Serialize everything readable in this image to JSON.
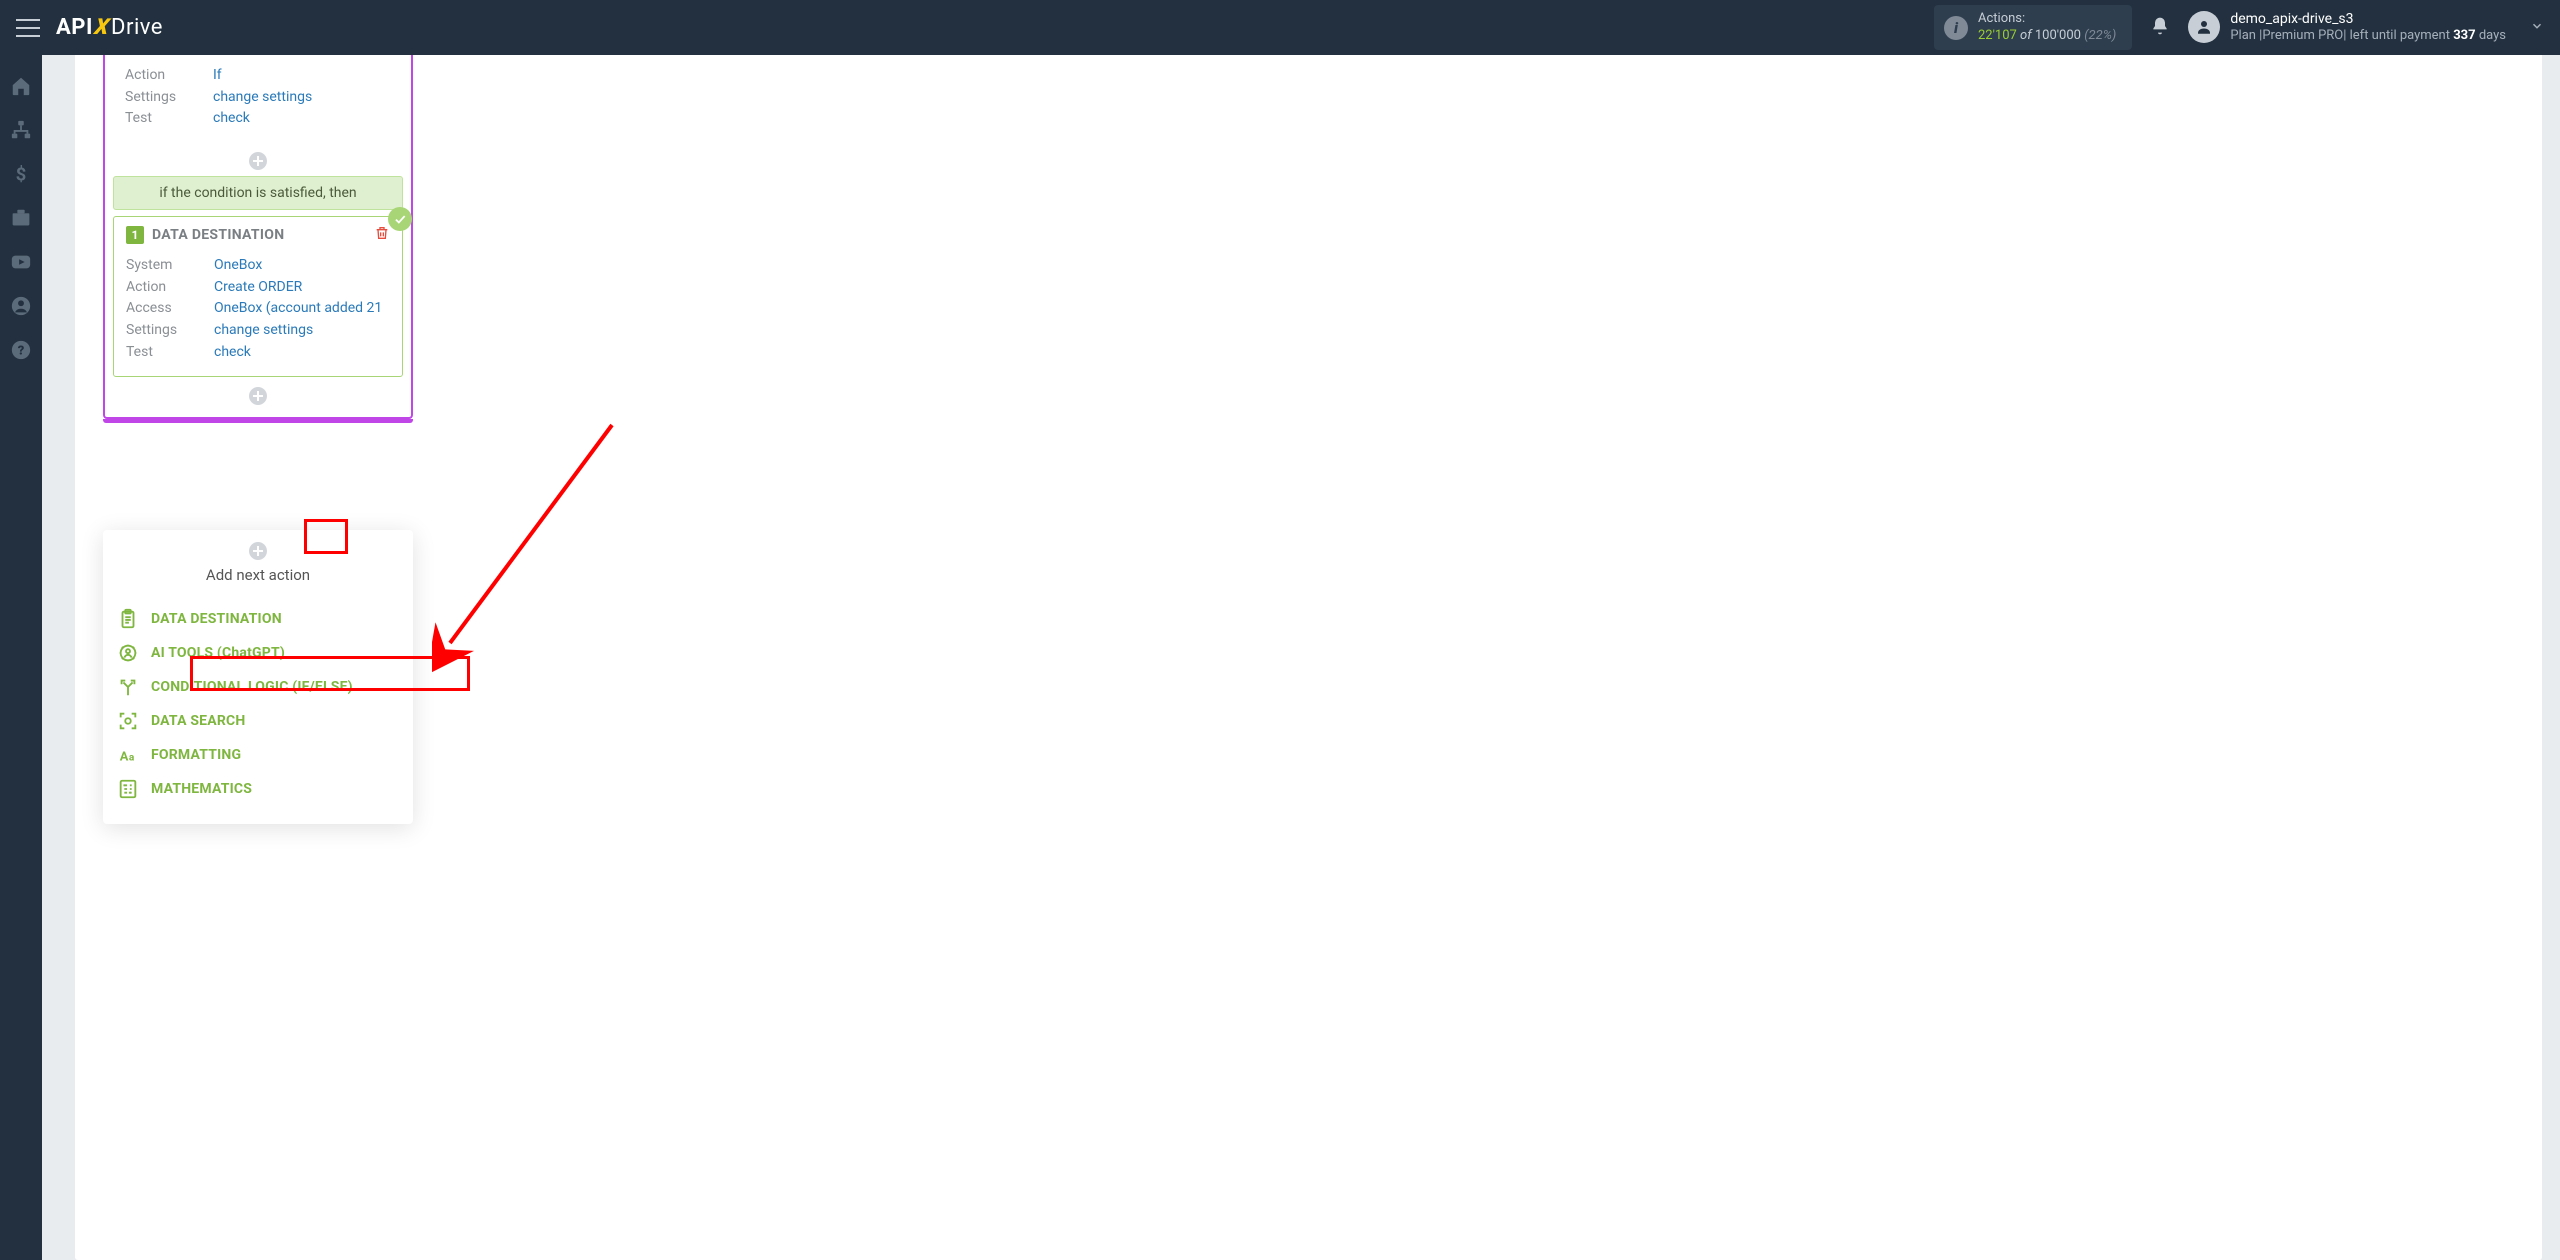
{
  "logo": {
    "api": "API",
    "x": "X",
    "drive": "Drive"
  },
  "header": {
    "actions_label": "Actions:",
    "actions_used": "22'107",
    "actions_of": "of",
    "actions_total": "100'000",
    "actions_pct": "(22%)",
    "username": "demo_apix-drive_s3",
    "plan_prefix": "Plan |Premium PRO| left until payment ",
    "plan_days": "337",
    "plan_suffix": " days"
  },
  "filter_card": {
    "rows": [
      {
        "k": "Action",
        "v": "If"
      },
      {
        "k": "Settings",
        "v": "change settings"
      },
      {
        "k": "Test",
        "v": "check"
      }
    ]
  },
  "condition_text": "if the condition is satisfied, then",
  "destination": {
    "number": "1",
    "title": "DATA DESTINATION",
    "rows": [
      {
        "k": "System",
        "v": "OneBox"
      },
      {
        "k": "Action",
        "v": "Create ORDER"
      },
      {
        "k": "Access",
        "v": "OneBox (account added 21"
      },
      {
        "k": "Settings",
        "v": "change settings"
      },
      {
        "k": "Test",
        "v": "check"
      }
    ]
  },
  "popup": {
    "title": "Add next action",
    "items": [
      {
        "id": "data-destination",
        "label": "DATA DESTINATION",
        "icon": "clipboard"
      },
      {
        "id": "ai-tools",
        "label": "AI TOOLS (ChatGPT)",
        "icon": "brain"
      },
      {
        "id": "conditional",
        "label": "CONDITIONAL LOGIC (IF/ELSE)",
        "icon": "branch"
      },
      {
        "id": "data-search",
        "label": "DATA SEARCH",
        "icon": "scan"
      },
      {
        "id": "formatting",
        "label": "FORMATTING",
        "icon": "aa"
      },
      {
        "id": "mathematics",
        "label": "MATHEMATICS",
        "icon": "calc"
      }
    ]
  }
}
